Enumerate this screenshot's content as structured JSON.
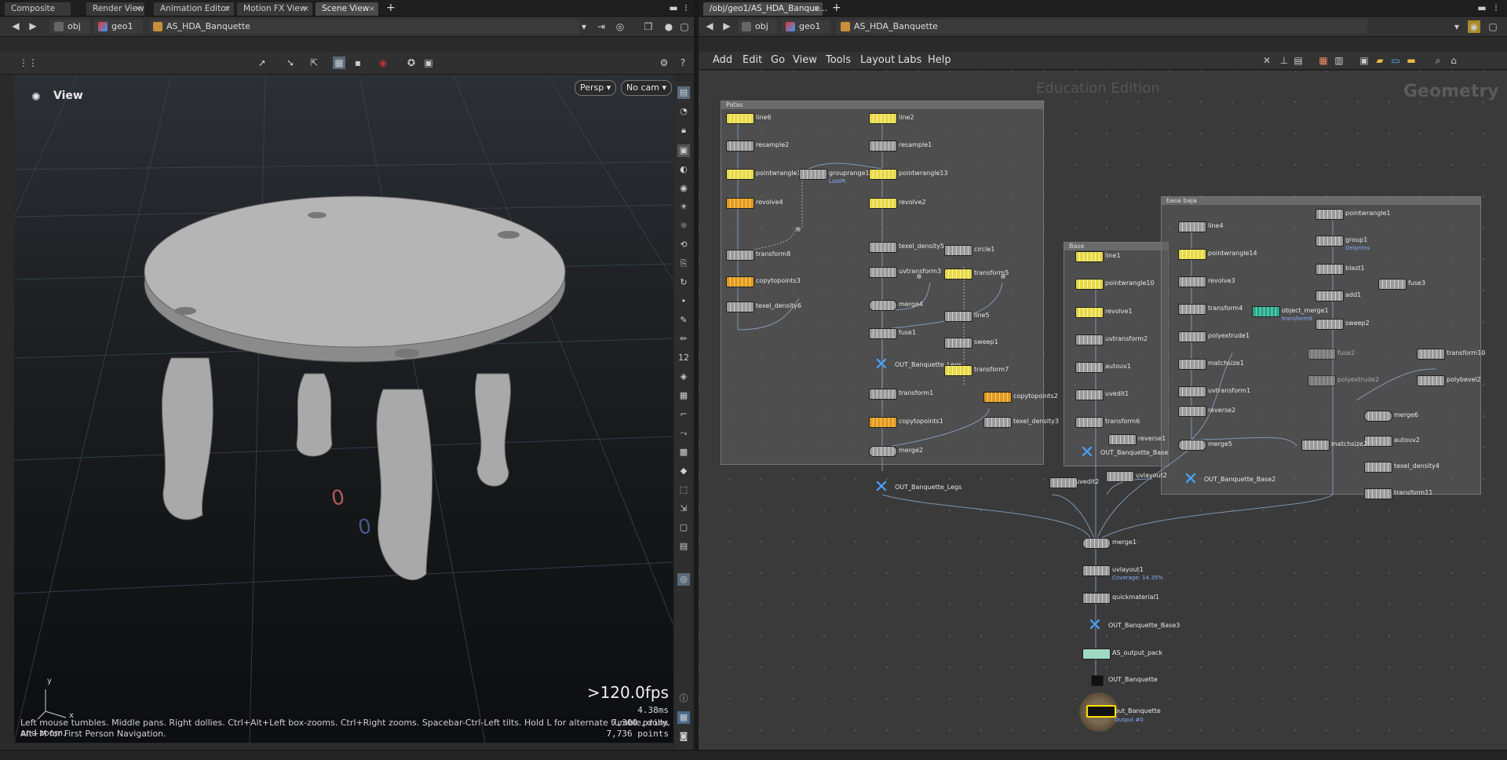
{
  "left_pane": {
    "tabs": [
      {
        "label": "Composite View"
      },
      {
        "label": "Render View"
      },
      {
        "label": "Animation Editor"
      },
      {
        "label": "Motion FX View"
      },
      {
        "label": "Scene View",
        "active": true
      }
    ],
    "path": {
      "obj": "obj",
      "geo": "geo1",
      "hda": "AS_HDA_Banquette"
    },
    "viewport": {
      "label": "View",
      "persp_button": "Persp ▾",
      "cam_button": "No cam ▾",
      "fps": ">120.0fps",
      "frame_time": "4.38ms",
      "prims": "7,300  prims",
      "points": "7,736  points",
      "hint_line1": "Left mouse tumbles. Middle pans. Right dollies. Ctrl+Alt+Left box-zooms. Ctrl+Right zooms. Spacebar-Ctrl-Left tilts. Hold L for alternate tumble, dolly, and zoom.",
      "hint_line2": "Alt+M for First Person Navigation.",
      "axis_x": "x",
      "axis_y": "y"
    }
  },
  "right_pane": {
    "tab_label": "/obj/geo1/AS_HDA_Banque...",
    "path": {
      "obj": "obj",
      "geo": "geo1",
      "hda": "AS_HDA_Banquette"
    },
    "menus": [
      "Add",
      "Edit",
      "Go",
      "View",
      "Tools",
      "Layout",
      "Labs",
      "Help"
    ],
    "watermark": "Education Edition",
    "context_label": "Geometry",
    "boxes": {
      "patas": "Patas",
      "base": "Base",
      "base_baja": "base baja"
    },
    "nodes": {
      "line6": "line6",
      "resample2": "resample2",
      "pointwrangle15": "pointwrangle15",
      "grouprange1": "grouprange1",
      "revolve4": "revolve4",
      "transform8": "transform8",
      "copytopoints3": "copytopoints3",
      "texel_density6": "texel_density6",
      "line2": "line2",
      "resample1": "resample1",
      "pointwrangle13": "pointwrangle13",
      "revolve2": "revolve2",
      "texel_density5": "texel_density5",
      "uvtransform3": "uvtransform3",
      "merge4": "merge4",
      "fuse1": "fuse1",
      "out_legs1": "OUT_Banquette_Legs",
      "transform1": "transform1",
      "copytopoints1": "copytopoints1",
      "merge2": "merge2",
      "circle1": "circle1",
      "transform5": "transform5",
      "line5": "line5",
      "sweep1": "sweep1",
      "transform7": "transform7",
      "copytopoints2": "copytopoints2",
      "texel_density3": "texel_density3",
      "out_legs2": "OUT_Banquette_Legs",
      "line1": "line1",
      "pointwrangle10": "pointwrangle10",
      "revolve1": "revolve1",
      "uvtransform2": "uvtransform2",
      "autouv1": "autouv1",
      "uvedit1": "uvedit1",
      "transform6": "transform6",
      "reverse1": "reverse1",
      "out_base": "OUT_Banquette_Base",
      "uvlayout2": "uvlayout2",
      "uvedit2": "uvedit2",
      "line4": "line4",
      "pointwrangle14": "pointwrangle14",
      "revolve3": "revolve3",
      "transform4": "transform4",
      "polyextrude1": "polyextrude1",
      "matchsize1": "matchsize1",
      "uvtransform1": "uvtransform1",
      "reverse2": "reverse2",
      "merge5": "merge5",
      "out_base2": "OUT_Banquette_Base2",
      "object_merge1": "object_merge1",
      "pointwrangle1": "pointwrangle1",
      "group1": "group1",
      "blast1": "blast1",
      "add1": "add1",
      "fuse3": "fuse3",
      "sweep2": "sweep2",
      "fuse2": "fuse2",
      "polyextrude2": "polyextrude2",
      "transform10": "transform10",
      "polybevel2": "polybevel2",
      "merge6": "merge6",
      "autouv2": "autouv2",
      "matchsize2": "matchsize2",
      "texel_density4": "texel_density4",
      "transform11": "transform11",
      "merge1": "merge1",
      "uvlayout1": "uvlayout1",
      "quickmaterial1": "quickmaterial1",
      "out_base3": "OUT_Banquette_Base3",
      "as_output_pack": "AS_output_pack",
      "out_banquette": "OUT_Banquette",
      "final": "out_Banquette"
    },
    "subs": {
      "lastpt": "LastPt",
      "coverage": "Coverage: 14.35%",
      "delprims": "Delprims",
      "transform9": "transform9",
      "output0": "Output #0"
    }
  }
}
